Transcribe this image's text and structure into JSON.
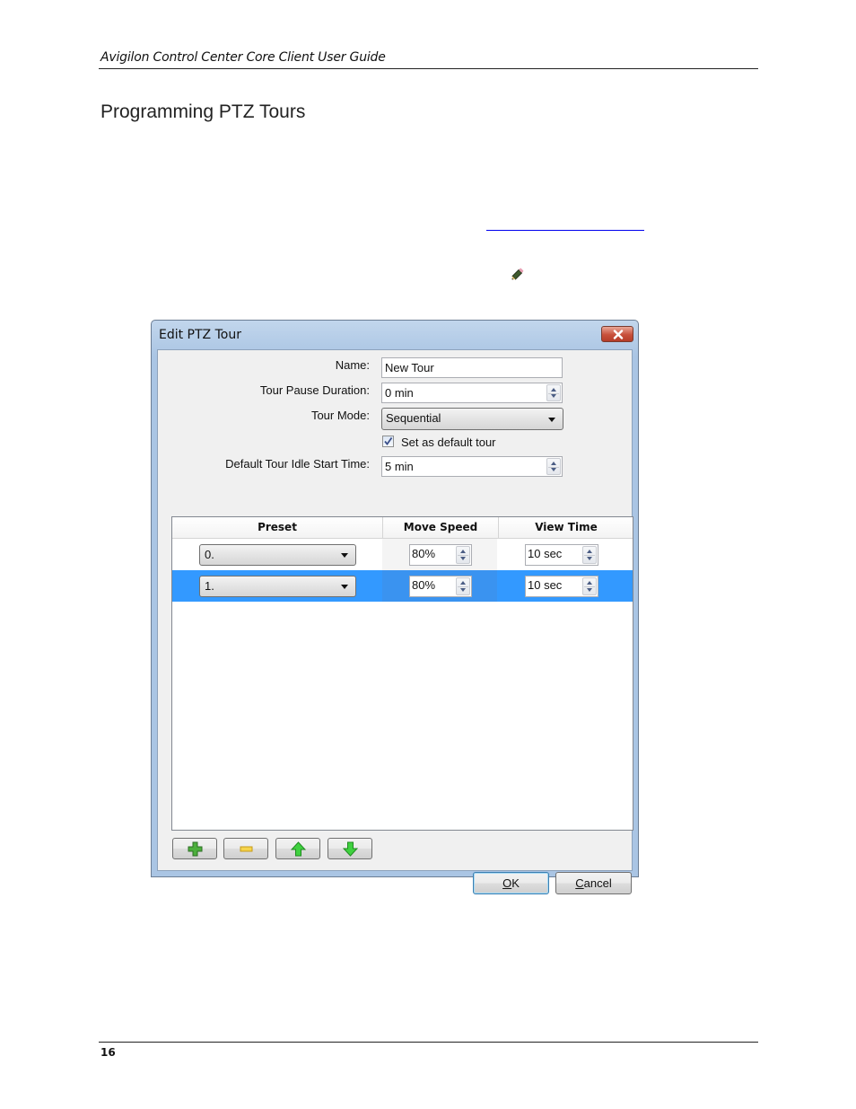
{
  "page": {
    "header": "Avigilon Control Center Core Client User Guide",
    "title": "Programming PTZ Tours",
    "page_number": "16",
    "link_color": "#0000ee"
  },
  "icons": {
    "inline_icon": "pencil-icon"
  },
  "dialog": {
    "title": "Edit PTZ Tour",
    "close_icon": "close-icon",
    "fields": {
      "name_label": "Name:",
      "name_value": "New Tour",
      "pause_label": "Tour Pause Duration:",
      "pause_value": "0 min",
      "mode_label": "Tour Mode:",
      "mode_value": "Sequential",
      "default_checkbox_label": "Set as default tour",
      "default_checked": true,
      "idle_label": "Default Tour Idle Start Time:",
      "idle_value": "5 min"
    },
    "grid": {
      "columns": [
        "Preset",
        "Move Speed",
        "View Time"
      ],
      "rows": [
        {
          "preset": "0.",
          "move_speed": "80%",
          "view_time": "10 sec",
          "selected": false
        },
        {
          "preset": "1.",
          "move_speed": "80%",
          "view_time": "10 sec",
          "selected": true
        }
      ],
      "selection_color": "#3399ff"
    },
    "toolbar": {
      "add_icon": "plus-icon",
      "remove_icon": "minus-icon",
      "up_icon": "arrow-up-icon",
      "down_icon": "arrow-down-icon"
    },
    "buttons": {
      "ok_mnemonic": "O",
      "ok_rest": "K",
      "cancel_mnemonic": "C",
      "cancel_rest": "ancel"
    }
  }
}
